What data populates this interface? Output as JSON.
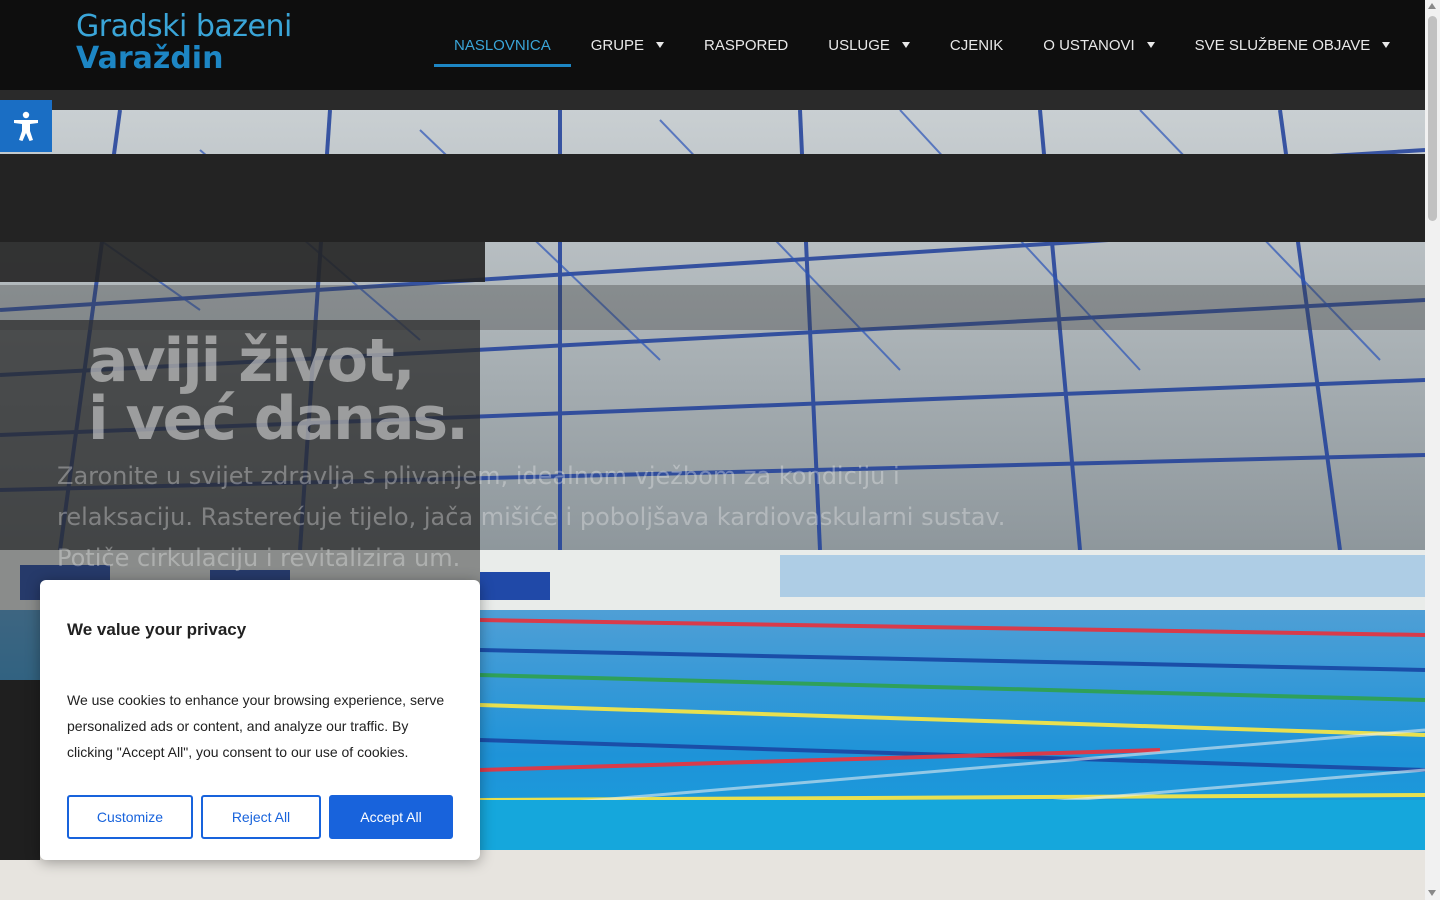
{
  "header": {
    "logo_line1": "Gradski bazeni",
    "logo_line2": "Varaždin",
    "nav": [
      {
        "label": "NASLOVNICA",
        "active": true,
        "dropdown": false
      },
      {
        "label": "GRUPE",
        "active": false,
        "dropdown": true
      },
      {
        "label": "RASPORED",
        "active": false,
        "dropdown": false
      },
      {
        "label": "USLUGE",
        "active": false,
        "dropdown": true
      },
      {
        "label": "CJENIK",
        "active": false,
        "dropdown": false
      },
      {
        "label": "O USTANOVI",
        "active": false,
        "dropdown": true
      },
      {
        "label": "SVE SLUŽBENE OBJAVE",
        "active": false,
        "dropdown": true
      }
    ]
  },
  "hero": {
    "title_line1": "aviji život,",
    "title_line2": "i već danas.",
    "text": "Zaronite u svijet zdravlja s plivanjem, idealnom vježbom za kondiciju i relaksaciju. Rasterećuje tijelo, jača mišiće i poboljšava kardiovaskularni sustav. Potiče cirkulaciju i revitalizira um."
  },
  "accessibility": {
    "icon": "accessibility-icon"
  },
  "cookie": {
    "title": "We value your privacy",
    "body": "We use cookies to enhance your browsing experience, serve personalized ads or content, and analyze our traffic. By clicking \"Accept All\", you consent to our use of cookies.",
    "customize_label": "Customize",
    "reject_label": "Reject All",
    "accept_label": "Accept All"
  },
  "colors": {
    "header_bg": "#0e0e0e",
    "accent": "#1d86c4",
    "button_blue": "#1863dc",
    "a11y_bg": "#1a6ec4"
  }
}
